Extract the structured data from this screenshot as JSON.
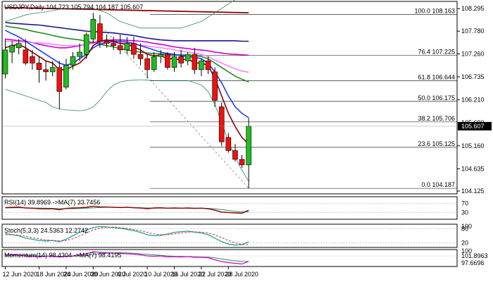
{
  "chart_data": {
    "type": "candlestick",
    "symbol": "USDJPY",
    "timeframe": "Daily",
    "header": {
      "symbol": "USDJPY,Daily",
      "open": "104.723",
      "high": "105.794",
      "low": "104.187",
      "close": "105.607"
    },
    "ylim": [
      104.06,
      108.46
    ],
    "y_ticks": [
      "108.295",
      "107.780",
      "107.260",
      "106.735",
      "106.210",
      "105.690",
      "105.160",
      "104.635",
      "104.125"
    ],
    "current_price": "105.607",
    "x_tick_labels": [
      {
        "label": "12 Jun 2020",
        "bar": 0
      },
      {
        "label": "18 Jun 2020",
        "bar": 5
      },
      {
        "label": "24 Jun 2020",
        "bar": 9
      },
      {
        "label": "30 Jun 2020",
        "bar": 13
      },
      {
        "label": "6 Jul 2020",
        "bar": 17
      },
      {
        "label": "10 Jul 2020",
        "bar": 21
      },
      {
        "label": "16 Jul 2020",
        "bar": 25
      },
      {
        "label": "22 Jul 2020",
        "bar": 29
      },
      {
        "label": "28 Jul 2020",
        "bar": 33
      }
    ],
    "candles": [
      {
        "o": 106.8,
        "h": 107.6,
        "l": 106.7,
        "c": 107.35
      },
      {
        "o": 107.3,
        "h": 107.55,
        "l": 107.05,
        "c": 107.45
      },
      {
        "o": 107.4,
        "h": 107.6,
        "l": 107.25,
        "c": 107.5
      },
      {
        "o": 107.35,
        "h": 107.6,
        "l": 107.0,
        "c": 107.05
      },
      {
        "o": 107.2,
        "h": 107.35,
        "l": 106.9,
        "c": 107.05
      },
      {
        "o": 107.05,
        "h": 107.2,
        "l": 106.6,
        "c": 106.9
      },
      {
        "o": 106.9,
        "h": 107.1,
        "l": 106.65,
        "c": 106.85
      },
      {
        "o": 106.85,
        "h": 107.1,
        "l": 106.75,
        "c": 106.95
      },
      {
        "o": 106.95,
        "h": 107.1,
        "l": 106.0,
        "c": 106.4
      },
      {
        "o": 106.5,
        "h": 107.15,
        "l": 106.45,
        "c": 107.0
      },
      {
        "o": 107.0,
        "h": 107.3,
        "l": 106.9,
        "c": 107.2
      },
      {
        "o": 107.2,
        "h": 107.5,
        "l": 107.1,
        "c": 107.3
      },
      {
        "o": 107.25,
        "h": 107.75,
        "l": 107.15,
        "c": 107.7
      },
      {
        "o": 107.6,
        "h": 108.2,
        "l": 107.5,
        "c": 108.05
      },
      {
        "o": 107.95,
        "h": 108.15,
        "l": 107.4,
        "c": 107.55
      },
      {
        "o": 107.55,
        "h": 107.7,
        "l": 107.4,
        "c": 107.5
      },
      {
        "o": 107.5,
        "h": 107.65,
        "l": 107.35,
        "c": 107.45
      },
      {
        "o": 107.45,
        "h": 107.7,
        "l": 107.25,
        "c": 107.35
      },
      {
        "o": 107.35,
        "h": 107.65,
        "l": 107.25,
        "c": 107.5
      },
      {
        "o": 107.5,
        "h": 107.65,
        "l": 107.15,
        "c": 107.25
      },
      {
        "o": 107.25,
        "h": 107.5,
        "l": 107.0,
        "c": 107.15
      },
      {
        "o": 107.15,
        "h": 107.25,
        "l": 106.7,
        "c": 106.9
      },
      {
        "o": 106.9,
        "h": 107.3,
        "l": 106.85,
        "c": 107.2
      },
      {
        "o": 107.2,
        "h": 107.35,
        "l": 107.05,
        "c": 107.25
      },
      {
        "o": 107.25,
        "h": 107.3,
        "l": 106.9,
        "c": 106.95
      },
      {
        "o": 106.95,
        "h": 107.3,
        "l": 106.85,
        "c": 107.2
      },
      {
        "o": 107.2,
        "h": 107.35,
        "l": 106.95,
        "c": 107.05
      },
      {
        "o": 107.1,
        "h": 107.3,
        "l": 107.0,
        "c": 107.25
      },
      {
        "o": 107.25,
        "h": 107.4,
        "l": 106.8,
        "c": 106.9
      },
      {
        "o": 106.9,
        "h": 107.15,
        "l": 106.75,
        "c": 107.1
      },
      {
        "o": 107.1,
        "h": 107.2,
        "l": 106.8,
        "c": 106.9
      },
      {
        "o": 106.85,
        "h": 106.95,
        "l": 106.05,
        "c": 106.2
      },
      {
        "o": 106.05,
        "h": 106.15,
        "l": 105.15,
        "c": 105.25
      },
      {
        "o": 105.35,
        "h": 105.45,
        "l": 105.0,
        "c": 105.05
      },
      {
        "o": 105.05,
        "h": 105.2,
        "l": 104.8,
        "c": 104.85
      },
      {
        "o": 104.85,
        "h": 104.95,
        "l": 104.65,
        "c": 104.723
      },
      {
        "o": 104.723,
        "h": 105.794,
        "l": 104.187,
        "c": 105.607
      }
    ],
    "moving_averages": [
      {
        "name": "Bollinger upper",
        "color": "#2e8b57",
        "values": [
          108.0,
          108.05,
          108.1,
          108.15,
          108.18,
          108.2,
          108.22,
          108.25,
          108.28,
          108.3,
          108.3,
          108.3,
          108.3,
          108.3,
          108.25,
          108.2,
          108.1,
          108.0,
          107.95,
          107.9,
          107.85,
          107.85,
          107.85,
          107.85,
          107.85,
          107.85,
          107.85,
          107.9,
          107.95,
          108.0,
          108.1,
          108.2,
          108.3,
          108.4,
          108.5,
          108.6,
          108.7
        ]
      },
      {
        "name": "Bollinger lower",
        "color": "#2e8b57",
        "values": [
          106.45,
          106.4,
          106.35,
          106.3,
          106.25,
          106.2,
          106.15,
          106.05,
          106.0,
          105.98,
          105.97,
          105.96,
          105.98,
          106.05,
          106.2,
          106.4,
          106.55,
          106.62,
          106.65,
          106.66,
          106.67,
          106.66,
          106.65,
          106.65,
          106.65,
          106.65,
          106.65,
          106.65,
          106.6,
          106.55,
          106.4,
          106.1,
          105.7,
          105.25,
          104.9,
          104.6,
          104.35
        ]
      },
      {
        "name": "MA navy",
        "color": "#1a1a8c",
        "values": [
          107.98,
          107.96,
          107.95,
          107.94,
          107.93,
          107.92,
          107.9,
          107.88,
          107.86,
          107.84,
          107.82,
          107.8,
          107.78,
          107.77,
          107.76,
          107.75,
          107.74,
          107.72,
          107.7,
          107.68,
          107.65,
          107.62,
          107.6,
          107.58,
          107.57,
          107.56,
          107.56,
          107.56,
          107.56,
          107.56,
          107.56,
          107.56,
          107.56,
          107.56,
          107.56,
          107.55,
          107.55
        ]
      },
      {
        "name": "MA green",
        "color": "#228b22",
        "values": [
          107.9,
          107.87,
          107.85,
          107.82,
          107.78,
          107.75,
          107.72,
          107.68,
          107.65,
          107.62,
          107.6,
          107.58,
          107.55,
          107.52,
          107.48,
          107.45,
          107.42,
          107.38,
          107.35,
          107.32,
          107.3,
          107.28,
          107.27,
          107.26,
          107.25,
          107.24,
          107.24,
          107.23,
          107.22,
          107.2,
          107.15,
          107.05,
          106.95,
          106.85,
          106.75,
          106.68,
          106.62
        ]
      },
      {
        "name": "MA magenta",
        "color": "#d000d0",
        "values": [
          107.6,
          107.58,
          107.56,
          107.55,
          107.52,
          107.48,
          107.45,
          107.42,
          107.4,
          107.4,
          107.42,
          107.45,
          107.48,
          107.52,
          107.55,
          107.57,
          107.58,
          107.58,
          107.57,
          107.56,
          107.55,
          107.53,
          107.5,
          107.48,
          107.45,
          107.42,
          107.4,
          107.38,
          107.36,
          107.35,
          107.33,
          107.3,
          107.28,
          107.26,
          107.25,
          107.24,
          107.23
        ]
      },
      {
        "name": "MA pink",
        "color": "#ff80ff",
        "values": [
          107.55,
          107.55,
          107.54,
          107.53,
          107.52,
          107.51,
          107.5,
          107.48,
          107.46,
          107.45,
          107.45,
          107.46,
          107.48,
          107.5,
          107.52,
          107.53,
          107.52,
          107.51,
          107.5,
          107.48,
          107.46,
          107.44,
          107.42,
          107.4,
          107.38,
          107.35,
          107.32,
          107.3,
          107.28,
          107.25,
          107.2,
          107.12,
          107.05,
          106.98,
          106.92,
          106.87,
          106.84
        ]
      },
      {
        "name": "MA blue",
        "color": "#1e3cff",
        "values": [
          107.8,
          107.72,
          107.65,
          107.55,
          107.45,
          107.35,
          107.25,
          107.15,
          107.05,
          107.0,
          107.05,
          107.15,
          107.25,
          107.4,
          107.48,
          107.52,
          107.55,
          107.55,
          107.53,
          107.5,
          107.45,
          107.4,
          107.35,
          107.3,
          107.27,
          107.25,
          107.22,
          107.2,
          107.18,
          107.15,
          107.05,
          106.85,
          106.6,
          106.3,
          106.05,
          105.9,
          105.8
        ]
      },
      {
        "name": "MA maroon",
        "color": "#8b0000",
        "values": [
          107.4,
          107.45,
          107.48,
          107.4,
          107.3,
          107.2,
          107.1,
          107.05,
          106.9,
          106.9,
          106.98,
          107.05,
          107.2,
          107.45,
          107.55,
          107.58,
          107.55,
          107.5,
          107.48,
          107.42,
          107.35,
          107.25,
          107.22,
          107.22,
          107.15,
          107.15,
          107.12,
          107.15,
          107.05,
          107.05,
          107.0,
          106.7,
          106.3,
          105.9,
          105.6,
          105.35,
          105.2
        ]
      }
    ],
    "trend_line": {
      "from": {
        "bar": 13,
        "price": 108.1
      },
      "to": {
        "bar": 36,
        "price": 104.19
      }
    },
    "resistance_line": {
      "from_bar": 0,
      "to_bar": 36,
      "start": 108.32,
      "end": 108.2
    },
    "fib_levels": [
      {
        "label": "100.0 108.163",
        "price": 108.163
      },
      {
        "label": "76.4 107.225",
        "price": 107.225
      },
      {
        "label": "61.8 106.644",
        "price": 106.644
      },
      {
        "label": "50.0 106.175",
        "price": 106.175
      },
      {
        "label": "38.2 105.706",
        "price": 105.706
      },
      {
        "label": "23.6 105.125",
        "price": 105.125
      },
      {
        "label": "0.0 104.187",
        "price": 104.187
      }
    ],
    "rsi": {
      "label": "RSI(14) 39.8969 ->MA(7) 33.7456",
      "ylim": [
        0,
        100
      ],
      "levels": [
        {
          "label": "70",
          "v": 70
        },
        {
          "label": "30",
          "v": 30
        }
      ],
      "values": [
        52,
        53,
        54,
        50,
        49,
        47,
        46,
        47,
        42,
        48,
        50,
        51,
        53,
        58,
        55,
        54,
        53,
        52,
        53,
        51,
        50,
        47,
        50,
        51,
        49,
        50,
        49,
        50,
        48,
        49,
        47,
        40,
        32,
        30,
        28,
        27,
        39.9
      ],
      "ma": [
        50,
        51,
        51,
        51,
        50,
        49,
        49,
        48,
        47,
        47,
        47,
        48,
        49,
        51,
        52,
        53,
        53,
        53,
        53,
        52,
        51,
        50,
        49,
        49,
        49,
        49,
        49,
        49,
        49,
        49,
        48,
        46,
        43,
        39,
        35,
        32,
        33.7
      ]
    },
    "stoch": {
      "label": "Stoch(5,3,3) 24.5363 12.2742",
      "ylim": [
        0,
        100
      ],
      "levels": [
        {
          "label": "80",
          "v": 80
        },
        {
          "label": "20",
          "v": 20
        }
      ],
      "top_label": "100",
      "main": [
        60,
        55,
        50,
        40,
        35,
        30,
        28,
        30,
        25,
        35,
        50,
        65,
        75,
        85,
        90,
        88,
        85,
        82,
        78,
        72,
        65,
        55,
        50,
        52,
        58,
        65,
        68,
        70,
        66,
        62,
        55,
        40,
        25,
        15,
        10,
        12,
        24.5
      ],
      "signal": [
        55,
        55,
        53,
        48,
        42,
        37,
        32,
        30,
        28,
        30,
        37,
        50,
        63,
        75,
        83,
        87,
        88,
        85,
        82,
        77,
        72,
        65,
        58,
        55,
        55,
        58,
        62,
        66,
        67,
        66,
        62,
        54,
        42,
        30,
        20,
        13,
        12.3
      ]
    },
    "momentum": {
      "label": "Momentum(14) 98.4304 ->MA(7) 98.4195",
      "ylim": [
        97.0,
        101.8
      ],
      "top_label": "101.8963",
      "bottom_label": "97.6696",
      "level_label": "100",
      "level": 100,
      "values": [
        100.3,
        100.4,
        100.2,
        100.0,
        99.9,
        99.8,
        99.9,
        100.0,
        99.7,
        99.9,
        100.0,
        100.3,
        100.6,
        101.2,
        101.0,
        100.9,
        100.8,
        100.7,
        100.6,
        100.5,
        100.3,
        100.0,
        99.9,
        100.0,
        99.7,
        99.8,
        99.7,
        99.8,
        99.6,
        99.6,
        99.5,
        98.9,
        98.4,
        98.1,
        97.9,
        97.7,
        98.43
      ],
      "ma": [
        100.0,
        100.1,
        100.2,
        100.2,
        100.1,
        100.0,
        99.95,
        99.9,
        99.85,
        99.85,
        99.9,
        100.0,
        100.15,
        100.4,
        100.6,
        100.75,
        100.85,
        100.9,
        100.85,
        100.75,
        100.6,
        100.45,
        100.3,
        100.15,
        100.0,
        99.9,
        99.85,
        99.8,
        99.75,
        99.7,
        99.65,
        99.45,
        99.15,
        98.85,
        98.6,
        98.45,
        98.42
      ]
    }
  }
}
